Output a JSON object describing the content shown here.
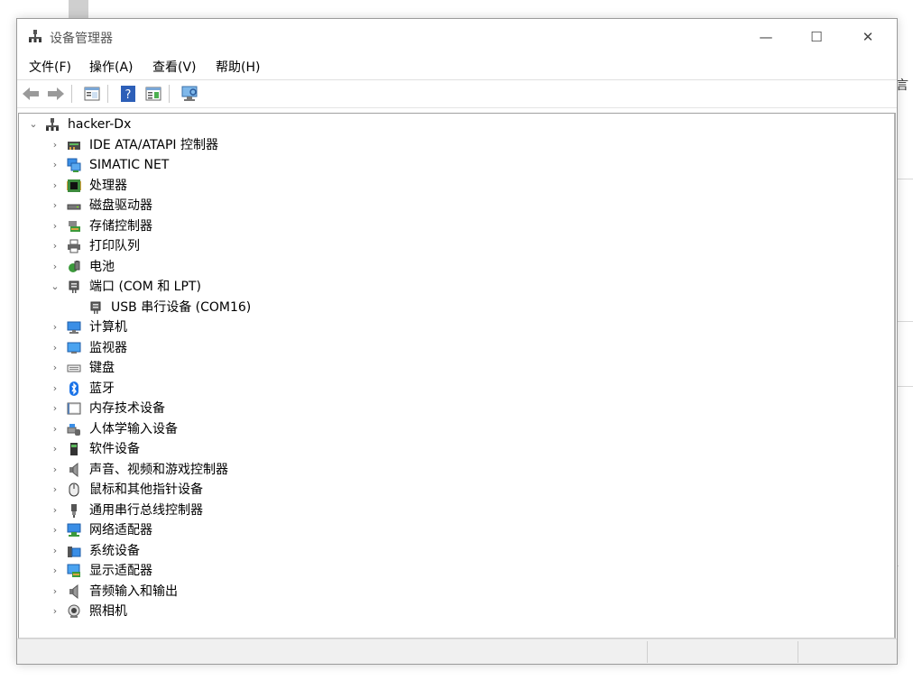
{
  "background": {
    "partial_glyph": "言",
    "edge_glyph": "/"
  },
  "window": {
    "title": "设备管理器",
    "buttons": {
      "minimize": "—",
      "maximize": "☐",
      "close": "✕"
    }
  },
  "menu": [
    {
      "label": "文件(F)"
    },
    {
      "label": "操作(A)"
    },
    {
      "label": "查看(V)"
    },
    {
      "label": "帮助(H)"
    }
  ],
  "toolbar": {
    "icons": [
      "back-arrow-icon",
      "forward-arrow-icon",
      "show-hide-tree-icon",
      "help-icon",
      "properties-icon",
      "scan-hardware-icon"
    ],
    "help_glyph": "?"
  },
  "tree": {
    "root": {
      "label": "hacker-Dx",
      "expanded": true,
      "arrow": "⌄"
    },
    "categories": [
      {
        "label": "IDE ATA/ATAPI 控制器",
        "icon": "ide-controller-icon",
        "arrow": "›"
      },
      {
        "label": "SIMATIC NET",
        "icon": "network-icon",
        "arrow": "›"
      },
      {
        "label": "处理器",
        "icon": "processor-icon",
        "arrow": "›"
      },
      {
        "label": "磁盘驱动器",
        "icon": "disk-drive-icon",
        "arrow": "›"
      },
      {
        "label": "存储控制器",
        "icon": "storage-controller-icon",
        "arrow": "›"
      },
      {
        "label": "打印队列",
        "icon": "printer-icon",
        "arrow": "›"
      },
      {
        "label": "电池",
        "icon": "battery-icon",
        "arrow": "›"
      },
      {
        "label": "端口 (COM 和 LPT)",
        "icon": "port-icon",
        "arrow": "⌄",
        "expanded": true,
        "children": [
          {
            "label": "USB 串行设备 (COM16)",
            "icon": "port-icon"
          }
        ]
      },
      {
        "label": "计算机",
        "icon": "computer-icon",
        "arrow": "›"
      },
      {
        "label": "监视器",
        "icon": "monitor-icon",
        "arrow": "›"
      },
      {
        "label": "键盘",
        "icon": "keyboard-icon",
        "arrow": "›"
      },
      {
        "label": "蓝牙",
        "icon": "bluetooth-icon",
        "arrow": "›"
      },
      {
        "label": "内存技术设备",
        "icon": "memory-device-icon",
        "arrow": "›"
      },
      {
        "label": "人体学输入设备",
        "icon": "hid-icon",
        "arrow": "›"
      },
      {
        "label": "软件设备",
        "icon": "software-device-icon",
        "arrow": "›"
      },
      {
        "label": "声音、视频和游戏控制器",
        "icon": "speaker-icon",
        "arrow": "›"
      },
      {
        "label": "鼠标和其他指针设备",
        "icon": "mouse-icon",
        "arrow": "›"
      },
      {
        "label": "通用串行总线控制器",
        "icon": "usb-icon",
        "arrow": "›"
      },
      {
        "label": "网络适配器",
        "icon": "network-adapter-icon",
        "arrow": "›"
      },
      {
        "label": "系统设备",
        "icon": "system-device-icon",
        "arrow": "›"
      },
      {
        "label": "显示适配器",
        "icon": "display-adapter-icon",
        "arrow": "›"
      },
      {
        "label": "音频输入和输出",
        "icon": "audio-io-icon",
        "arrow": "›"
      },
      {
        "label": "照相机",
        "icon": "camera-icon",
        "arrow": "›"
      }
    ]
  },
  "colors": {
    "bluetooth": "#1a73e8",
    "monitor_blue": "#3a8ee6",
    "accent_green": "#3c9a3c"
  }
}
